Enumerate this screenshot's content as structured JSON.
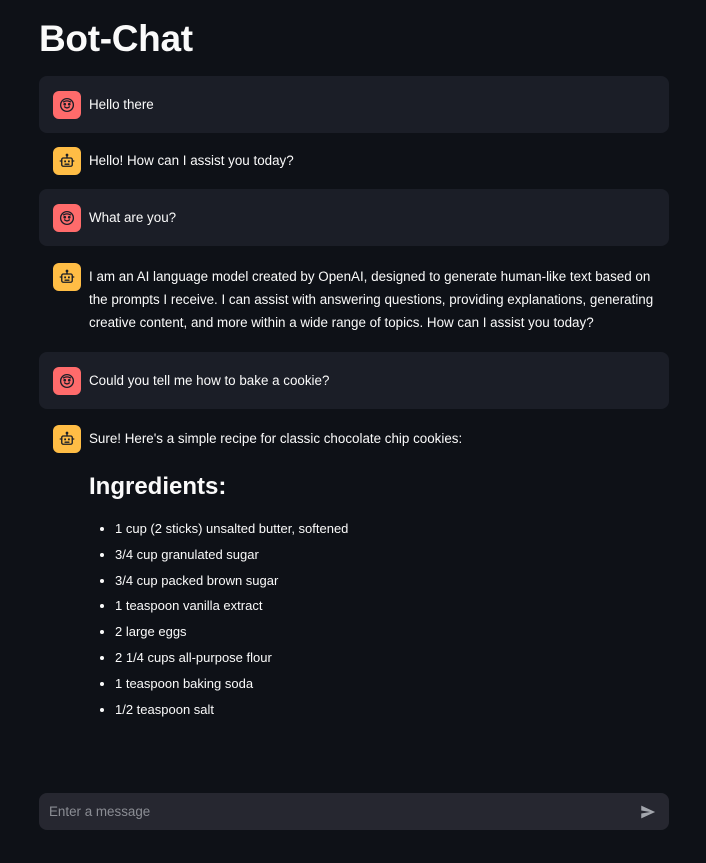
{
  "app": {
    "title": "Bot-Chat"
  },
  "colors": {
    "background": "#0e1117",
    "user_bubble": "#1b1e27",
    "user_avatar": "#ff6b6b",
    "bot_avatar": "#ffbd45",
    "input_bg": "#262730"
  },
  "messages": [
    {
      "role": "user",
      "avatar_icon": "smiley-face-icon",
      "text": "Hello there"
    },
    {
      "role": "assistant",
      "avatar_icon": "robot-icon",
      "text": "Hello! How can I assist you today?"
    },
    {
      "role": "user",
      "avatar_icon": "smiley-face-icon",
      "text": "What are you?"
    },
    {
      "role": "assistant",
      "avatar_icon": "robot-icon",
      "text": "I am an AI language model created by OpenAI, designed to generate human-like text based on the prompts I receive. I can assist with answering questions, providing explanations, generating creative content, and more within a wide range of topics. How can I assist you today?"
    },
    {
      "role": "user",
      "avatar_icon": "smiley-face-icon",
      "text": "Could you tell me how to bake a cookie?"
    },
    {
      "role": "assistant",
      "avatar_icon": "robot-icon",
      "text": "Sure! Here's a simple recipe for classic chocolate chip cookies:",
      "heading": "Ingredients:",
      "ingredients": [
        "1 cup (2 sticks) unsalted butter, softened",
        "3/4 cup granulated sugar",
        "3/4 cup packed brown sugar",
        "1 teaspoon vanilla extract",
        "2 large eggs",
        "2 1/4 cups all-purpose flour",
        "1 teaspoon baking soda",
        "1/2 teaspoon salt"
      ]
    }
  ],
  "chat_input": {
    "placeholder": "Enter a message",
    "value": "",
    "send_icon": "send-icon"
  }
}
